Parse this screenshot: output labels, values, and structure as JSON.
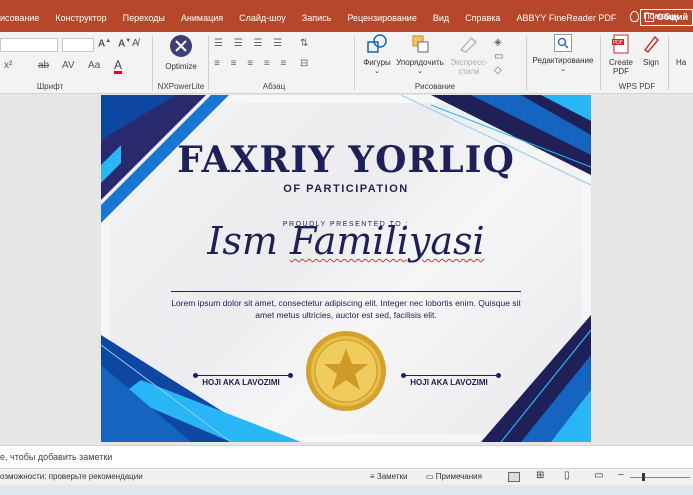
{
  "tabs": [
    "исование",
    "Конструктор",
    "Переходы",
    "Анимация",
    "Слайд-шоу",
    "Запись",
    "Рецензирование",
    "Вид",
    "Справка",
    "ABBYY FineReader PDF"
  ],
  "tell_me": "Помощн",
  "share_label": "Общий",
  "ribbon": {
    "groups": {
      "font": "Шрифт",
      "nxpowerlite": "NXPowerLite",
      "paragraph": "Абзац",
      "drawing": "Рисование",
      "wps": "WPS PDF"
    },
    "buttons": {
      "optimize": "Optimize",
      "shapes": "Фигуры",
      "arrange": "Упорядочить",
      "quick_styles": "Экспресс-стили",
      "editing": "Редактирование",
      "create_pdf": "Create PDF",
      "sign": "Sign",
      "right_cut": "На"
    }
  },
  "certificate": {
    "title": "FAXRIY YORLIQ",
    "subtitle": "OF PARTICIPATION",
    "presented": "PROUDLY PRESENTED TO :",
    "name_first": "Ism",
    "name_last": "Familiyasi",
    "body": "Lorem ipsum dolor sit amet, consectetur adipiscing elit. Integer nec lobortis enim. Quisque sit amet metus ultricies, auctor est sed, facilisis elit.",
    "signer_left": "HOJI AKA LAVOZIMI",
    "signer_right": "HOJI AKA LAVOZIMI"
  },
  "notes_placeholder": "е, чтобы добавить заметки",
  "status": {
    "accessibility": "озможности: проверьте рекомендации",
    "notes_btn": "Заметки",
    "comments_btn": "Примечания"
  },
  "colors": {
    "ribbon_red": "#b7472a",
    "navy": "#1e2057",
    "blue": "#1565c0",
    "cyan": "#29b6f6",
    "gold": "#e0b63c"
  }
}
